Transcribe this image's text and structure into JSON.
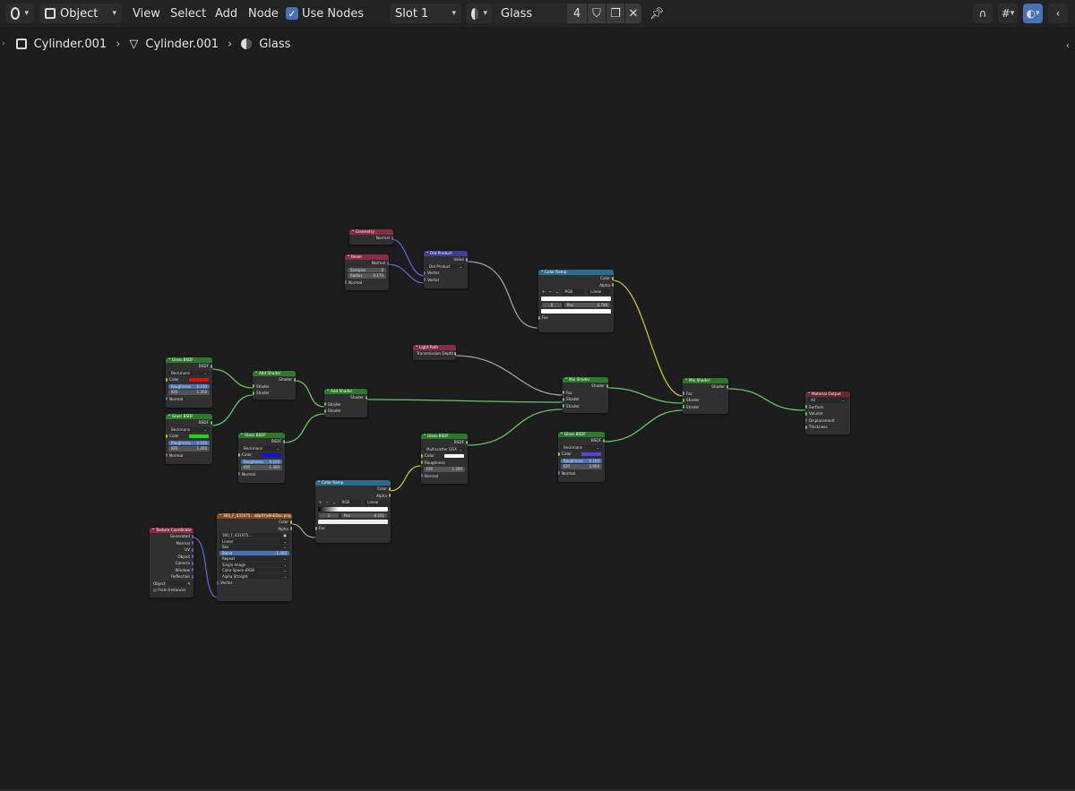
{
  "header": {
    "editor_icon": "shader-editor-icon",
    "mode": "Object",
    "menus": [
      "View",
      "Select",
      "Add",
      "Node"
    ],
    "use_nodes_label": "Use Nodes",
    "slot": "Slot 1",
    "material_name": "Glass",
    "user_count": "4"
  },
  "breadcrumb": [
    "Cylinder.001",
    "Cylinder.001",
    "Glass"
  ],
  "nodes": {
    "geometry": {
      "title": "Geometry",
      "normal": "Normal"
    },
    "bevel": {
      "title": "Bevel",
      "normal_out": "Normal",
      "samples_label": "Samples",
      "samples": "4",
      "radius_label": "Radius",
      "radius": "0.170",
      "normal_in": "Normal"
    },
    "dot": {
      "title": "Dot Product",
      "value": "Value",
      "op": "Dot Product",
      "vec1": "Vector",
      "vec2": "Vector"
    },
    "ramp1": {
      "title": "Color Ramp",
      "color": "Color",
      "alpha": "Alpha",
      "mode": "RGB",
      "interp": "Linear",
      "index": "0",
      "pos_label": "Pos",
      "pos": "0.740",
      "fac": "Fac"
    },
    "lightpath": {
      "title": "Light Path",
      "out": "Transmission Depth"
    },
    "glass1": {
      "title": "Glass BSDF",
      "bsdf": "BSDF",
      "dist": "Beckmann",
      "color": "Color",
      "rough_label": "Roughness",
      "rough": "0.100",
      "ior_label": "IOR",
      "ior": "1.350",
      "normal": "Normal",
      "swatch": "#e01010"
    },
    "glass2": {
      "title": "Glass BSDF",
      "bsdf": "BSDF",
      "dist": "Beckmann",
      "color": "Color",
      "rough_label": "Roughness",
      "rough": "0.100",
      "ior_label": "IOR",
      "ior": "1.400",
      "normal": "Normal",
      "swatch": "#10e010"
    },
    "glass3": {
      "title": "Glass BSDF",
      "bsdf": "BSDF",
      "dist": "Beckmann",
      "color": "Color",
      "rough_label": "Roughness",
      "rough": "0.100",
      "ior_label": "IOR",
      "ior": "1.300",
      "normal": "Normal",
      "swatch": "#1010e8"
    },
    "glass4": {
      "title": "Glass BSDF",
      "bsdf": "BSDF",
      "dist": "Multiscatter GGX",
      "color": "Color",
      "rough_label": "Roughness",
      "ior_label": "IOR",
      "ior": "1.200",
      "normal": "Normal",
      "swatch": "#ffffff"
    },
    "glass5": {
      "title": "Glass BSDF",
      "bsdf": "BSDF",
      "dist": "Beckmann",
      "color": "Color",
      "rough_label": "Roughness",
      "rough": "0.194",
      "ior_label": "IOR",
      "ior": "0.900",
      "normal": "Normal",
      "swatch": "#5a3de8"
    },
    "add1": {
      "title": "Add Shader",
      "out": "Shader",
      "in1": "Shader",
      "in2": "Shader"
    },
    "add2": {
      "title": "Add Shader",
      "out": "Shader",
      "in1": "Shader",
      "in2": "Shader"
    },
    "mix1": {
      "title": "Mix Shader",
      "out": "Shader",
      "fac": "Fac",
      "in1": "Shader",
      "in2": "Shader"
    },
    "mix2": {
      "title": "Mix Shader",
      "out": "Shader",
      "fac": "Fac",
      "in1": "Shader",
      "in2": "Shader"
    },
    "output": {
      "title": "Material Output",
      "target": "All",
      "surface": "Surface",
      "volume": "Volume",
      "disp": "Displacement",
      "thick": "Thickness"
    },
    "ramp2": {
      "title": "Color Ramp",
      "color": "Color",
      "alpha": "Alpha",
      "mode": "RGB",
      "interp": "Linear",
      "index": "1",
      "pos_label": "Pos",
      "pos": "0.251",
      "fac": "Fac"
    },
    "image": {
      "title": "360_F_431075...a8pXYy8nEDoc.png",
      "color": "Color",
      "alpha": "Alpha",
      "file": "360_F_431075...",
      "interp": "Linear",
      "proj": "Box",
      "blend_label": "Blend",
      "blend": "1.000",
      "ext": "Repeat",
      "src": "Single Image",
      "cs_label": "Color Space",
      "cs": "sRGB",
      "alpha_label": "Alpha",
      "alpha_mode": "Straight",
      "vector": "Vector"
    },
    "texcoord": {
      "title": "Texture Coordinate",
      "generated": "Generated",
      "normal": "Normal",
      "uv": "UV",
      "object": "Object",
      "camera": "Camera",
      "window": "Window",
      "reflection": "Reflection",
      "obj_label": "Object",
      "instancer": "From Instancer"
    }
  }
}
